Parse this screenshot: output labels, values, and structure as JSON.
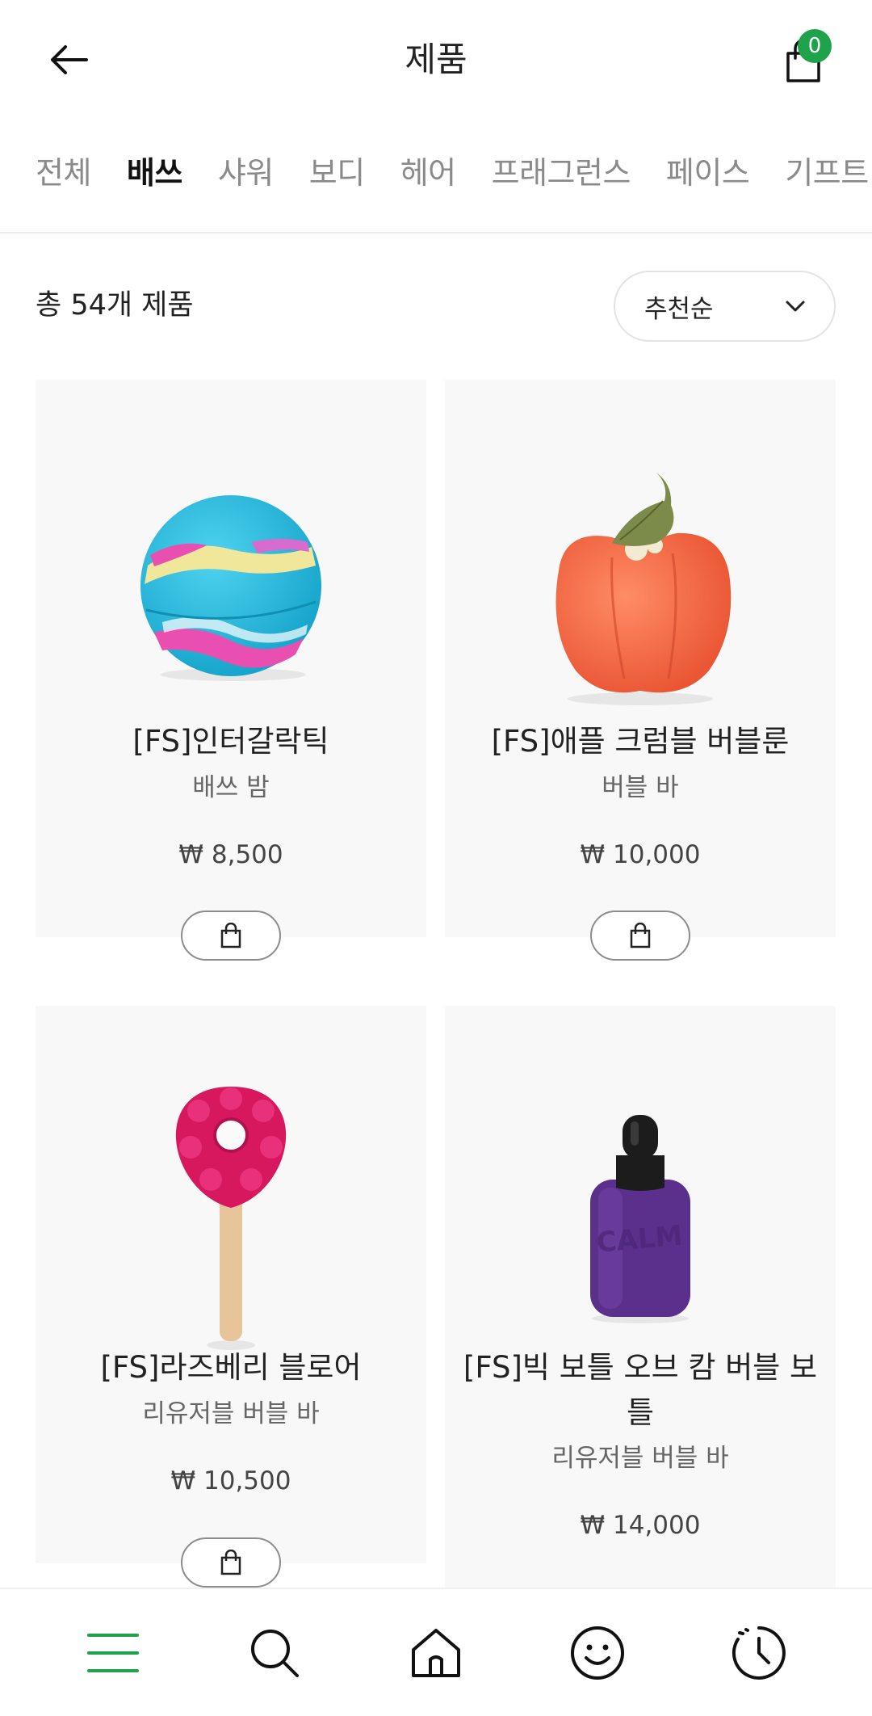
{
  "header": {
    "title": "제품",
    "cart_count": "0"
  },
  "tabs": [
    {
      "label": "전체"
    },
    {
      "label": "배쓰"
    },
    {
      "label": "샤워"
    },
    {
      "label": "보디"
    },
    {
      "label": "헤어"
    },
    {
      "label": "프래그런스"
    },
    {
      "label": "페이스"
    },
    {
      "label": "기프트"
    }
  ],
  "list": {
    "count_text": "총 54개 제품",
    "sort_label": "추천순"
  },
  "products": [
    {
      "name": "[FS]인터갈락틱",
      "category": "배쓰 밤",
      "price": "₩ 8,500"
    },
    {
      "name": "[FS]애플 크럼블 버블룬",
      "category": "버블 바",
      "price": "₩ 10,000"
    },
    {
      "name": "[FS]라즈베리 블로어",
      "category": "리유저블 버블 바",
      "price": "₩ 10,500"
    },
    {
      "name": "[FS]빅 보틀 오브 캄 버블 보틀",
      "category": "리유저블 버블 바",
      "price": "₩ 14,000"
    }
  ],
  "colors": {
    "accent_green": "#1fa34a",
    "card_bg": "#f8f8f8"
  },
  "bottom_nav": [
    "menu-icon",
    "search-icon",
    "home-icon",
    "smiley-icon",
    "history-icon"
  ]
}
